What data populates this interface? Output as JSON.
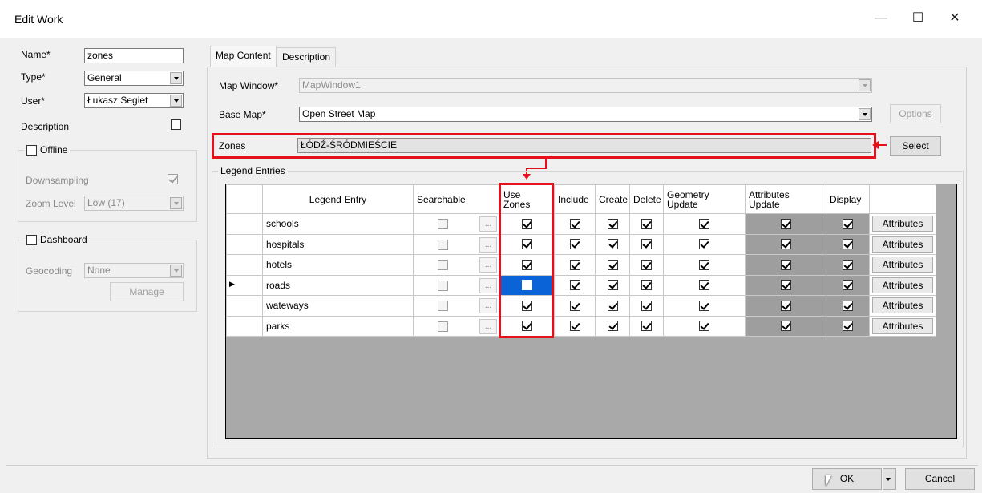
{
  "window": {
    "title": "Edit Work",
    "minimize": "—",
    "maximize": "☐",
    "close": "✕"
  },
  "left": {
    "name_label": "Name*",
    "name_value": "zones",
    "type_label": "Type*",
    "type_value": "General",
    "user_label": "User*",
    "user_value": "Łukasz Segiet",
    "description_label": "Description",
    "offline": {
      "label": "Offline",
      "downsampling_label": "Downsampling",
      "downsampling_checked": true,
      "zoom_label": "Zoom Level",
      "zoom_value": "Low (17)"
    },
    "dashboard": {
      "label": "Dashboard",
      "geocoding_label": "Geocoding",
      "geocoding_value": "None",
      "manage_label": "Manage"
    }
  },
  "tabs": [
    "Map Content",
    "Description"
  ],
  "map": {
    "window_label": "Map Window*",
    "window_value": "MapWindow1",
    "basemap_label": "Base Map*",
    "basemap_value": "Open Street Map",
    "options_label": "Options",
    "zones_label": "Zones",
    "zones_value": "ŁÓDŹ-ŚRÓDMIEŚCIE",
    "select_label": "Select"
  },
  "legend": {
    "group_label": "Legend Entries",
    "headers": {
      "entry": "Legend Entry",
      "searchable": "Searchable",
      "use_zones_1": "Use",
      "use_zones_2": "Zones",
      "include": "Include",
      "create": "Create",
      "delete": "Delete",
      "geometry_1": "Geometry",
      "geometry_2": "Update",
      "attributes_1": "Attributes",
      "attributes_2": "Update",
      "display": "Display"
    },
    "ellipsis": "...",
    "attributes_button": "Attributes",
    "current_row_marker": "▶",
    "rows": [
      {
        "name": "schools",
        "searchable": false,
        "use_zones": true,
        "include": true,
        "create": true,
        "delete": true,
        "geometry": true,
        "attributes": true,
        "display": true
      },
      {
        "name": "hospitals",
        "searchable": false,
        "use_zones": true,
        "include": true,
        "create": true,
        "delete": true,
        "geometry": true,
        "attributes": true,
        "display": true
      },
      {
        "name": "hotels",
        "searchable": false,
        "use_zones": true,
        "include": true,
        "create": true,
        "delete": true,
        "geometry": true,
        "attributes": true,
        "display": true
      },
      {
        "name": "roads",
        "searchable": false,
        "use_zones": false,
        "include": true,
        "create": true,
        "delete": true,
        "geometry": true,
        "attributes": true,
        "display": true
      },
      {
        "name": "wateways",
        "searchable": false,
        "use_zones": true,
        "include": true,
        "create": true,
        "delete": true,
        "geometry": true,
        "attributes": true,
        "display": true
      },
      {
        "name": "parks",
        "searchable": false,
        "use_zones": true,
        "include": true,
        "create": true,
        "delete": true,
        "geometry": true,
        "attributes": true,
        "display": true
      }
    ]
  },
  "footer": {
    "ok_label": "OK",
    "cancel_label": "Cancel"
  }
}
